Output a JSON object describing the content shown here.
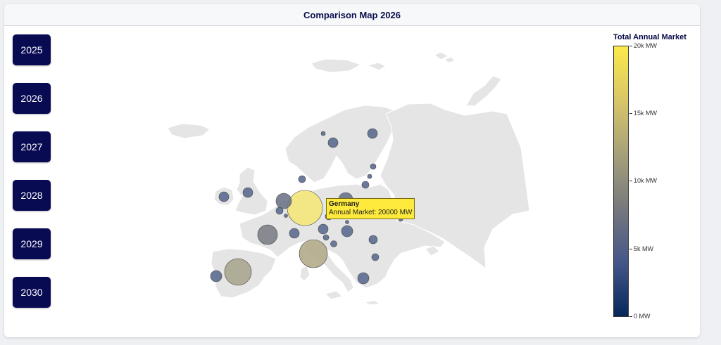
{
  "title": "Comparison Map 2026",
  "years": [
    "2025",
    "2026",
    "2027",
    "2028",
    "2029",
    "2030"
  ],
  "legend": {
    "title": "Total Annual Market",
    "ticks": [
      "20k MW",
      "15k MW",
      "10k MW",
      "5k MW",
      "0 MW"
    ]
  },
  "tooltip": {
    "country": "Germany",
    "text": "Annual Market: 20000 MW"
  },
  "colors": {
    "button": "#080a52",
    "land": "#e5e5e5",
    "border": "#ffffff",
    "highlight": "#fce94a"
  }
}
